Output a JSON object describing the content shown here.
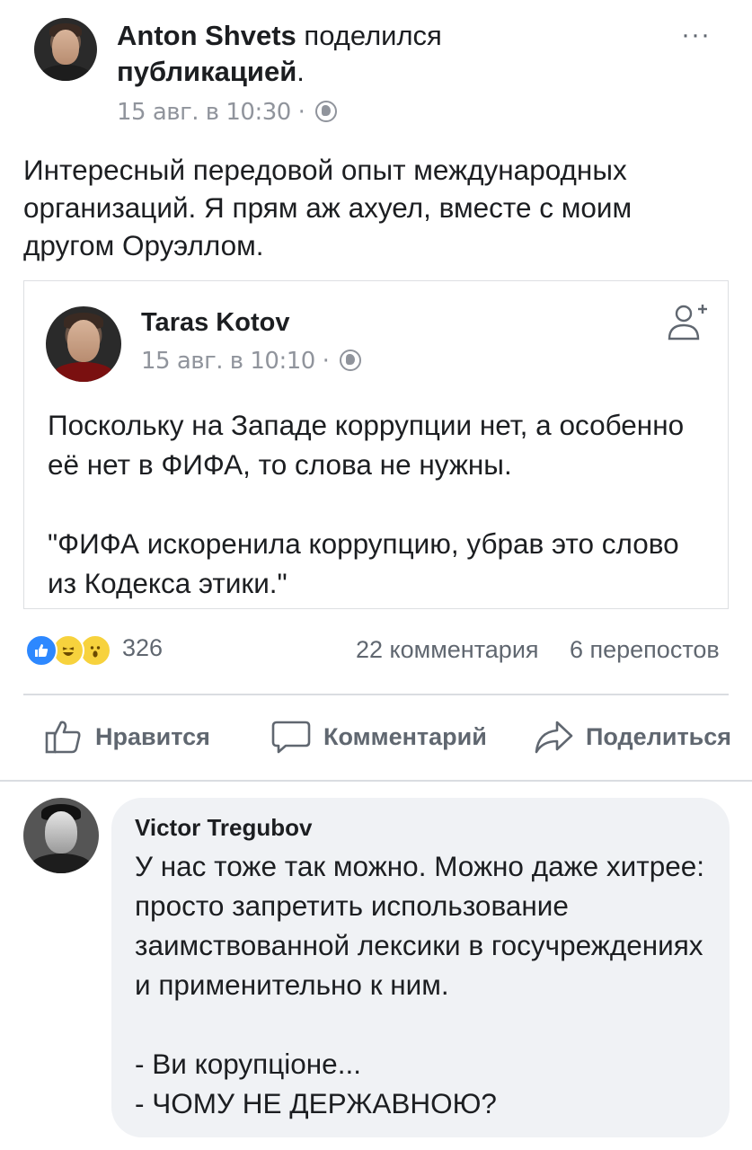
{
  "post": {
    "author": "Anton Shvets",
    "action_text": "поделился",
    "action_object": "публикацией",
    "action_suffix": ".",
    "timestamp": "15 авг. в 10:30",
    "separator": "·",
    "text": "Интересный передовой опыт международных организаций. Я прям аж ахуел, вместе с моим другом Оруэллом."
  },
  "shared_post": {
    "author": "Taras Kotov",
    "timestamp": "15 авг. в 10:10",
    "separator": "·",
    "text": "Поскольку на Западе коррупции нет, а особенно её нет в ФИФА, то слова не нужны.\n\n\"ФИФА искоренила коррупцию, убрав это слово из Кодекса этики.\""
  },
  "stats": {
    "reactions_count": "326",
    "comments": "22 комментария",
    "shares": "6 перепостов"
  },
  "actions": {
    "like": "Нравится",
    "comment": "Комментарий",
    "share": "Поделиться"
  },
  "comment": {
    "author": "Victor Tregubov",
    "text": "У нас тоже так можно. Можно даже хитрее: просто запретить использование заимствованной лексики в госучреждениях и применительно к ним.\n\n- Ви корупціоне...\n- ЧОМУ НЕ ДЕРЖАВНОЮ?"
  },
  "icons": {
    "more": "more-horizontal-icon",
    "privacy": "globe-icon",
    "add_friend": "add-friend-icon",
    "like": "thumbs-up-icon",
    "comment": "speech-bubble-icon",
    "share": "share-arrow-icon"
  },
  "colors": {
    "like_blue": "#2d88ff",
    "reaction_yellow": "#f7d23d",
    "meta_grey": "#90949c",
    "bubble_bg": "#f0f2f5"
  }
}
